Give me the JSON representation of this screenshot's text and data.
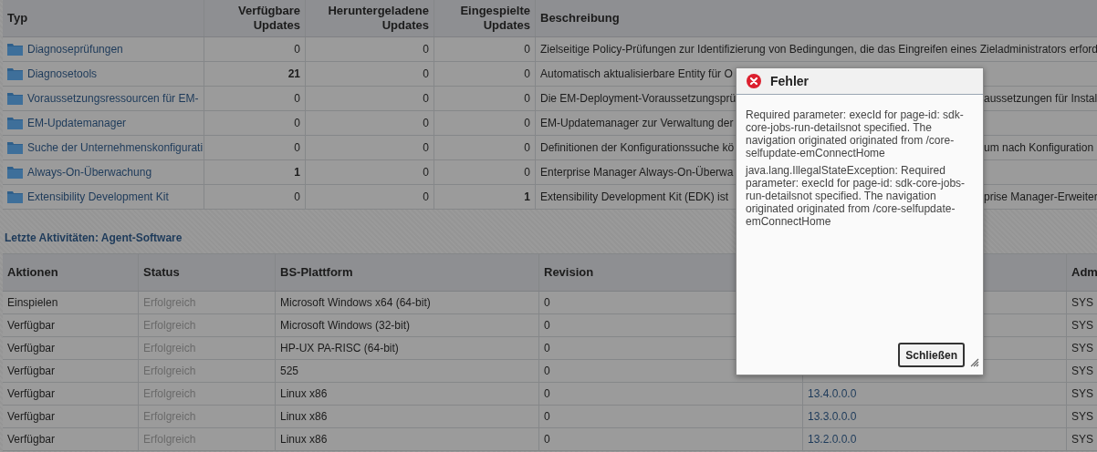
{
  "updates_table": {
    "columns": [
      "Typ",
      "Verfügbare Updates",
      "Heruntergeladene Updates",
      "Eingespielte Updates",
      "Beschreibung"
    ],
    "rows": [
      {
        "type": "Diagnoseprüfungen",
        "available": {
          "value": "0",
          "bold": false
        },
        "downloaded": {
          "value": "0",
          "bold": false
        },
        "applied": {
          "value": "0",
          "bold": false
        },
        "description": {
          "before": "Zielseitige Policy-Prüfungen zur Identifizierung von Bedingungen, die das Eingreifen eines Zieladministrators erford"
        }
      },
      {
        "type": "Diagnosetools",
        "available": {
          "value": "21",
          "bold": true
        },
        "downloaded": {
          "value": "0",
          "bold": false
        },
        "applied": {
          "value": "0",
          "bold": false
        },
        "description": {
          "before": "Automatisch aktualisierbare Entity für O"
        }
      },
      {
        "type": "Voraussetzungsressourcen für EM-",
        "available": {
          "value": "0",
          "bold": false
        },
        "downloaded": {
          "value": "0",
          "bold": false
        },
        "applied": {
          "value": "0",
          "bold": false
        },
        "description": {
          "before": "Die EM-Deployment-Voraussetzungsprü",
          "after": "aussetzungen für Instal"
        }
      },
      {
        "type": "EM-Updatemanager",
        "available": {
          "value": "0",
          "bold": false
        },
        "downloaded": {
          "value": "0",
          "bold": false
        },
        "applied": {
          "value": "0",
          "bold": false
        },
        "description": {
          "before": "EM-Updatemanager zur Verwaltung der"
        }
      },
      {
        "type": "Suche der Unternehmenskonfigurati",
        "available": {
          "value": "0",
          "bold": false
        },
        "downloaded": {
          "value": "0",
          "bold": false
        },
        "applied": {
          "value": "0",
          "bold": false
        },
        "description": {
          "before": "Definitionen der Konfigurationssuche kö",
          "after": "um nach Konfiguration"
        }
      },
      {
        "type": "Always-On-Überwachung",
        "available": {
          "value": "1",
          "bold": true
        },
        "downloaded": {
          "value": "0",
          "bold": false
        },
        "applied": {
          "value": "0",
          "bold": false
        },
        "description": {
          "before": "Enterprise Manager Always-On-Überwa"
        }
      },
      {
        "type": "Extensibility Development Kit",
        "available": {
          "value": "0",
          "bold": false
        },
        "downloaded": {
          "value": "0",
          "bold": false
        },
        "applied": {
          "value": "1",
          "bold": true
        },
        "description": {
          "before": "Extensibility Development Kit (EDK) ist",
          "after": "prise Manager-Erweiter"
        }
      }
    ]
  },
  "activity_section": {
    "title": "Letzte Aktivitäten: Agent-Software",
    "columns": [
      "Aktionen",
      "Status",
      "BS-Plattform",
      "Revision",
      "Adm"
    ],
    "rows": [
      {
        "action": "Einspielen",
        "status": "Erfolgreich",
        "platform": "Microsoft Windows x64 (64-bit)",
        "revision": "0",
        "admin": "SYS"
      },
      {
        "action": "Verfügbar",
        "status": "Erfolgreich",
        "platform": "Microsoft Windows (32-bit)",
        "revision": "0",
        "admin": "SYS"
      },
      {
        "action": "Verfügbar",
        "status": "Erfolgreich",
        "platform": "HP-UX PA-RISC (64-bit)",
        "revision": "0",
        "admin": "SYS"
      },
      {
        "action": "Verfügbar",
        "status": "Erfolgreich",
        "platform": "525",
        "revision": "0",
        "admin": "SYS"
      },
      {
        "action": "Verfügbar",
        "status": "Erfolgreich",
        "platform": "Linux x86",
        "revision": "0",
        "column_5": "13.4.0.0.0",
        "admin": "SYS"
      },
      {
        "action": "Verfügbar",
        "status": "Erfolgreich",
        "platform": "Linux x86",
        "revision": "0",
        "column_5": "13.3.0.0.0",
        "admin": "SYS"
      },
      {
        "action": "Verfügbar",
        "status": "Erfolgreich",
        "platform": "Linux x86",
        "revision": "0",
        "column_5": "13.2.0.0.0",
        "admin": "SYS"
      }
    ]
  },
  "error_dialog": {
    "title": "Fehler",
    "messages": [
      "Required parameter: execId for page-id: sdk-core-jobs-run-detailsnot specified. The navigation originated originated from /core-selfupdate-emConnectHome",
      "java.lang.IllegalStateException: Required parameter: execId for page-id: sdk-core-jobs-run-detailsnot specified. The navigation originated originated from /core-selfupdate-emConnectHome"
    ],
    "button": "Schließen"
  }
}
